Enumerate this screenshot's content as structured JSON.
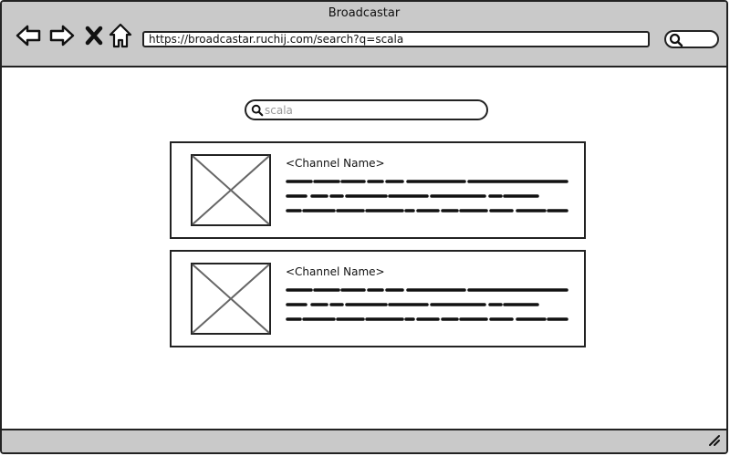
{
  "window": {
    "title": "Broadcastar"
  },
  "toolbar": {
    "url": "https://broadcastar.ruchij.com/search?q=scala",
    "icons": {
      "back": "arrow-left-icon",
      "forward": "arrow-right-icon",
      "stop": "close-icon",
      "home": "home-icon",
      "search": "search-icon"
    }
  },
  "search": {
    "placeholder": "scala"
  },
  "results": [
    {
      "channel_name": "<Channel Name>"
    },
    {
      "channel_name": "<Channel Name>"
    }
  ]
}
